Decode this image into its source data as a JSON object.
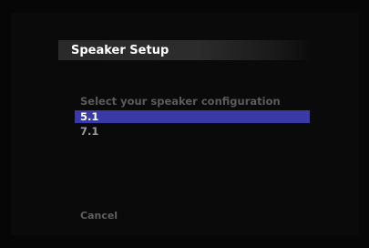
{
  "dialog": {
    "title": "Speaker Setup",
    "prompt": "Select your speaker configuration",
    "options": [
      {
        "label": "5.1",
        "selected": true
      },
      {
        "label": "7.1",
        "selected": false
      }
    ],
    "cancel_label": "Cancel"
  },
  "colors": {
    "background": "#060606",
    "title_bar": "#2c2c2c",
    "selection": "#3a3aa6",
    "title_text": "#ffffff",
    "dim_text": "#5b5b5b"
  }
}
